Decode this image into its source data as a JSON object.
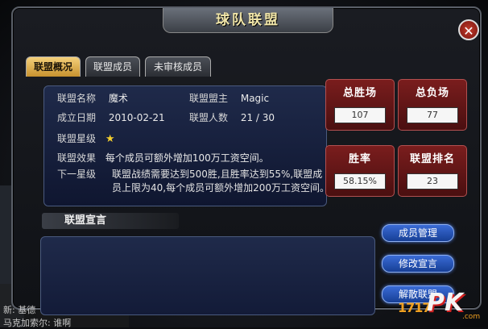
{
  "dialog": {
    "title": "球队联盟",
    "close_symbol": "✕"
  },
  "tabs": [
    {
      "label": "联盟概况",
      "active": true
    },
    {
      "label": "联盟成员",
      "active": false
    },
    {
      "label": "未审核成员",
      "active": false
    }
  ],
  "overview": {
    "name_label": "联盟名称",
    "name_value": "魔术",
    "leader_label": "联盟盟主",
    "leader_value": "Magic",
    "founded_label": "成立日期",
    "founded_value": "2010-02-21",
    "members_label": "联盟人数",
    "members_value": "21 / 30",
    "level_label": "联盟星级",
    "level_stars": "★",
    "effect_label": "联盟效果",
    "effect_value": "每个成员可额外增加100万工资空间。",
    "next_label": "下一星级",
    "next_value_line1": "联盟战绩需要达到500胜,且胜率达到55%,联盟成",
    "next_value_line2": "员上限为40,每个成员可额外增加200万工资空间。"
  },
  "stats": {
    "total_wins_title": "总胜场",
    "total_wins_value": "107",
    "total_losses_title": "总负场",
    "total_losses_value": "77",
    "win_rate_title": "胜率",
    "win_rate_value": "58.15%",
    "rank_title": "联盟排名",
    "rank_value": "23"
  },
  "declaration": {
    "title": "联盟宣言",
    "text": ""
  },
  "actions": {
    "manage_label": "成员管理",
    "edit_label": "修改宣言",
    "disband_label": "解散联盟"
  },
  "chat": {
    "line1": "新: 基德",
    "line2": "马克加索尔: 谁啊"
  },
  "watermark": {
    "num": "1717",
    "pk": "PK",
    "com": ".com"
  },
  "colors": {
    "tab_active": "#e0b050",
    "stat_box": "#6a1818",
    "button_blue": "#2a55c0",
    "overview_bg": "#1a2446"
  }
}
